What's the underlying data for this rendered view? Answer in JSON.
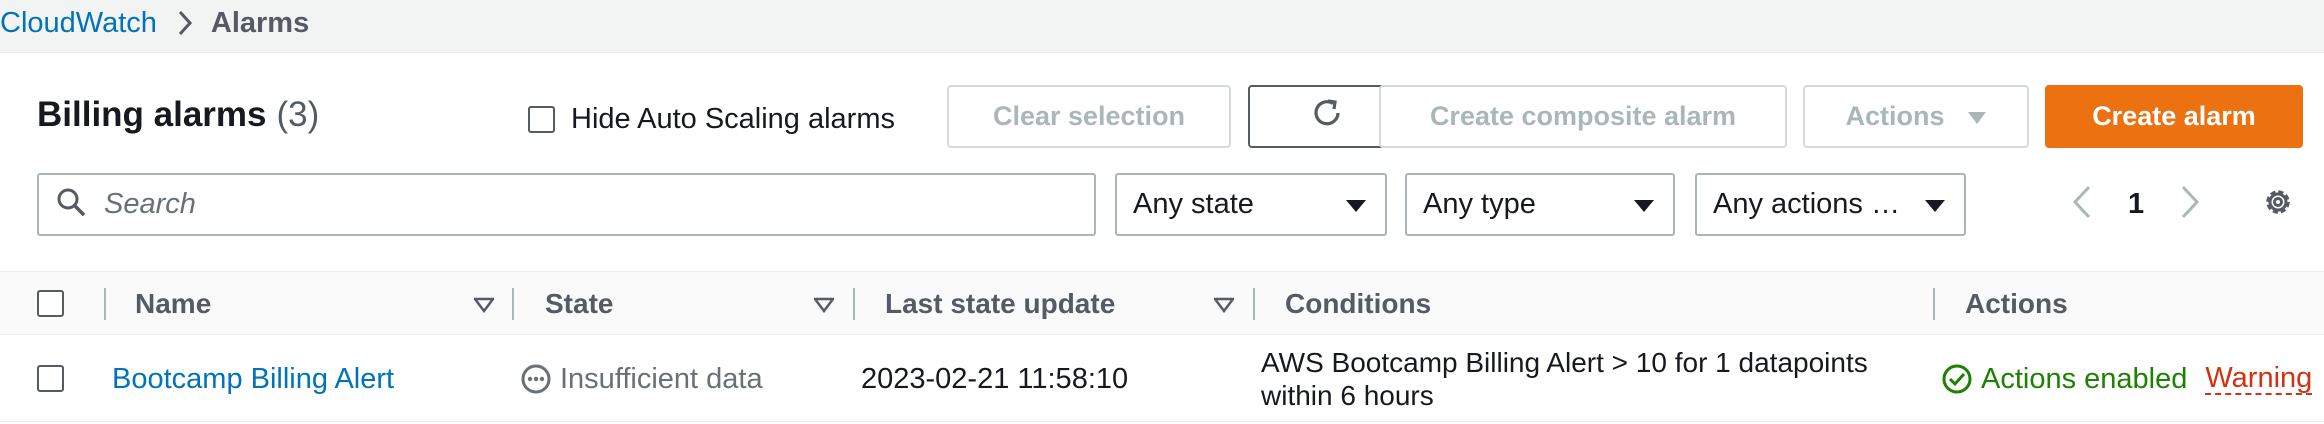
{
  "breadcrumb": {
    "root": "CloudWatch",
    "current": "Alarms"
  },
  "header": {
    "title": "Billing alarms",
    "count": "(3)"
  },
  "hide_autoscaling": {
    "label": "Hide Auto Scaling alarms",
    "checked": false
  },
  "toolbar": {
    "clear_selection": "Clear selection",
    "create_composite": "Create composite alarm",
    "actions": "Actions",
    "create_alarm": "Create alarm"
  },
  "filters": {
    "search_placeholder": "Search",
    "state": "Any state",
    "type": "Any type",
    "actions": "Any actions …"
  },
  "pagination": {
    "page": "1"
  },
  "table": {
    "columns": [
      "Name",
      "State",
      "Last state update",
      "Conditions",
      "Actions"
    ],
    "rows": [
      {
        "name": "Bootcamp Billing Alert",
        "state": "Insufficient data",
        "last_update": "2023-02-21 11:58:10",
        "condition_line1": "AWS Bootcamp Billing Alert > 10 for 1 datapoints",
        "condition_line2": "within 6 hours",
        "actions_status": "Actions enabled",
        "actions_warning": "Warning"
      }
    ]
  },
  "colors": {
    "link": "#0073bb",
    "primary": "#ec7211",
    "success": "#1d8102",
    "warning": "#d13212"
  }
}
